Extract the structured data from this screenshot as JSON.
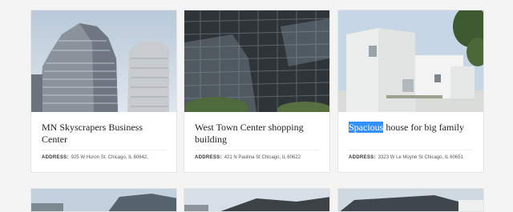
{
  "listings": [
    {
      "title": "MN Skyscrapers Business Center",
      "title_highlight": "",
      "address_label": "ADDRESS:",
      "address": "925 W Huron St, Chicago, IL 60642,"
    },
    {
      "title": "West Town Center shopping building",
      "title_highlight": "",
      "address_label": "ADDRESS:",
      "address": "421 N Paulina St Chicago, IL 60622"
    },
    {
      "title": " house for big family",
      "title_highlight": "Spacious",
      "address_label": "ADDRESS:",
      "address": "3323 W Le Moyne St Chicago, IL 60651"
    }
  ],
  "colors": {
    "selection": "#3390ff",
    "background": "#f4f4f4"
  }
}
